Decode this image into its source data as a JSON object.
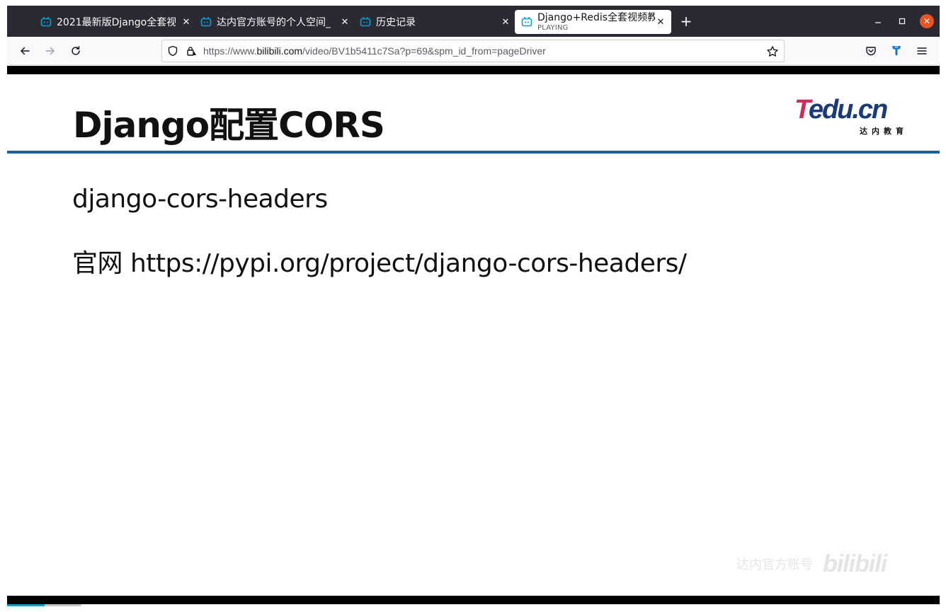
{
  "browser": {
    "tabs": [
      {
        "title": "2021最新版Django全套视",
        "active": false
      },
      {
        "title": "达内官方账号的个人空间_",
        "active": false
      },
      {
        "title": "历史记录",
        "active": false
      },
      {
        "title": "Django+Redis全套视频教",
        "subtitle": "PLAYING",
        "active": true
      }
    ],
    "new_tab_label": "+",
    "url_prefix": "https://www.",
    "url_host": "bilibili.com",
    "url_path": "/video/BV1b5411c7Sa?p=69&spm_id_from=pageDriver",
    "icons": {
      "tab_favicon": "bilibili-tv-icon",
      "back": "back-arrow-icon",
      "forward": "forward-arrow-icon",
      "reload": "reload-icon",
      "shield": "tracking-protection-shield-icon",
      "lock": "lock-warning-icon",
      "bookmark": "star-icon",
      "pocket": "pocket-icon",
      "extension": "extension-icon",
      "menu": "hamburger-menu-icon"
    },
    "colors": {
      "tabbar_bg": "#2b2a33",
      "favicon": "#00a1d6",
      "close_window": "#e95420"
    }
  },
  "slide": {
    "title": "Django配置CORS",
    "bullet1": "django-cors-headers",
    "bullet2": "官网 https://pypi.org/project/django-cors-headers/",
    "logo": {
      "brand_T": "T",
      "brand_rest": "edu.cn",
      "subtitle": "达内教育"
    },
    "colors": {
      "title_rule": "#1f5f99",
      "logo_red": "#d22a57",
      "logo_blue": "#1b3a7a"
    }
  },
  "watermark": {
    "text": "达内官方账号",
    "brand": "bilibili"
  },
  "player": {
    "progress_fraction": 0.04,
    "buffer_fraction": 0.08
  }
}
